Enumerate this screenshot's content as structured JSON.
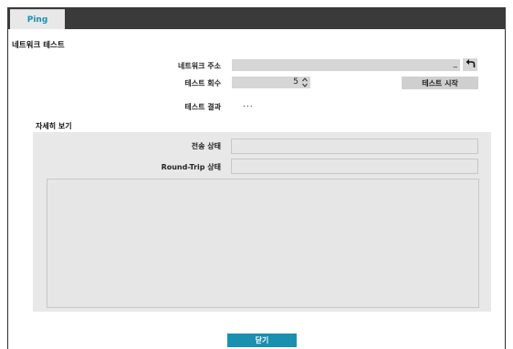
{
  "tabs": [
    {
      "label": "Ping",
      "active": true
    }
  ],
  "section_title": "네트워크 테스트",
  "address": {
    "label": "네트워크 주소",
    "value": "_"
  },
  "count": {
    "label": "테스트 회수",
    "value": "5"
  },
  "start_button": "테스트 시작",
  "result": {
    "label": "테스트 결과",
    "value": "..."
  },
  "details": {
    "title": "자세히 보기",
    "transmit_label": "전송 상태",
    "transmit_value": "",
    "roundtrip_label": "Round-Trip 상태",
    "roundtrip_value": "",
    "log_text": ""
  },
  "close_button": "닫기",
  "icons": {
    "reset": "undo-arrow-icon",
    "stepper": "stepper-arrows-icon"
  },
  "colors": {
    "accent": "#1a8fb0",
    "tabbar": "#3a3a3a",
    "field": "#d6d6d6",
    "panel": "#e8e8e8"
  }
}
